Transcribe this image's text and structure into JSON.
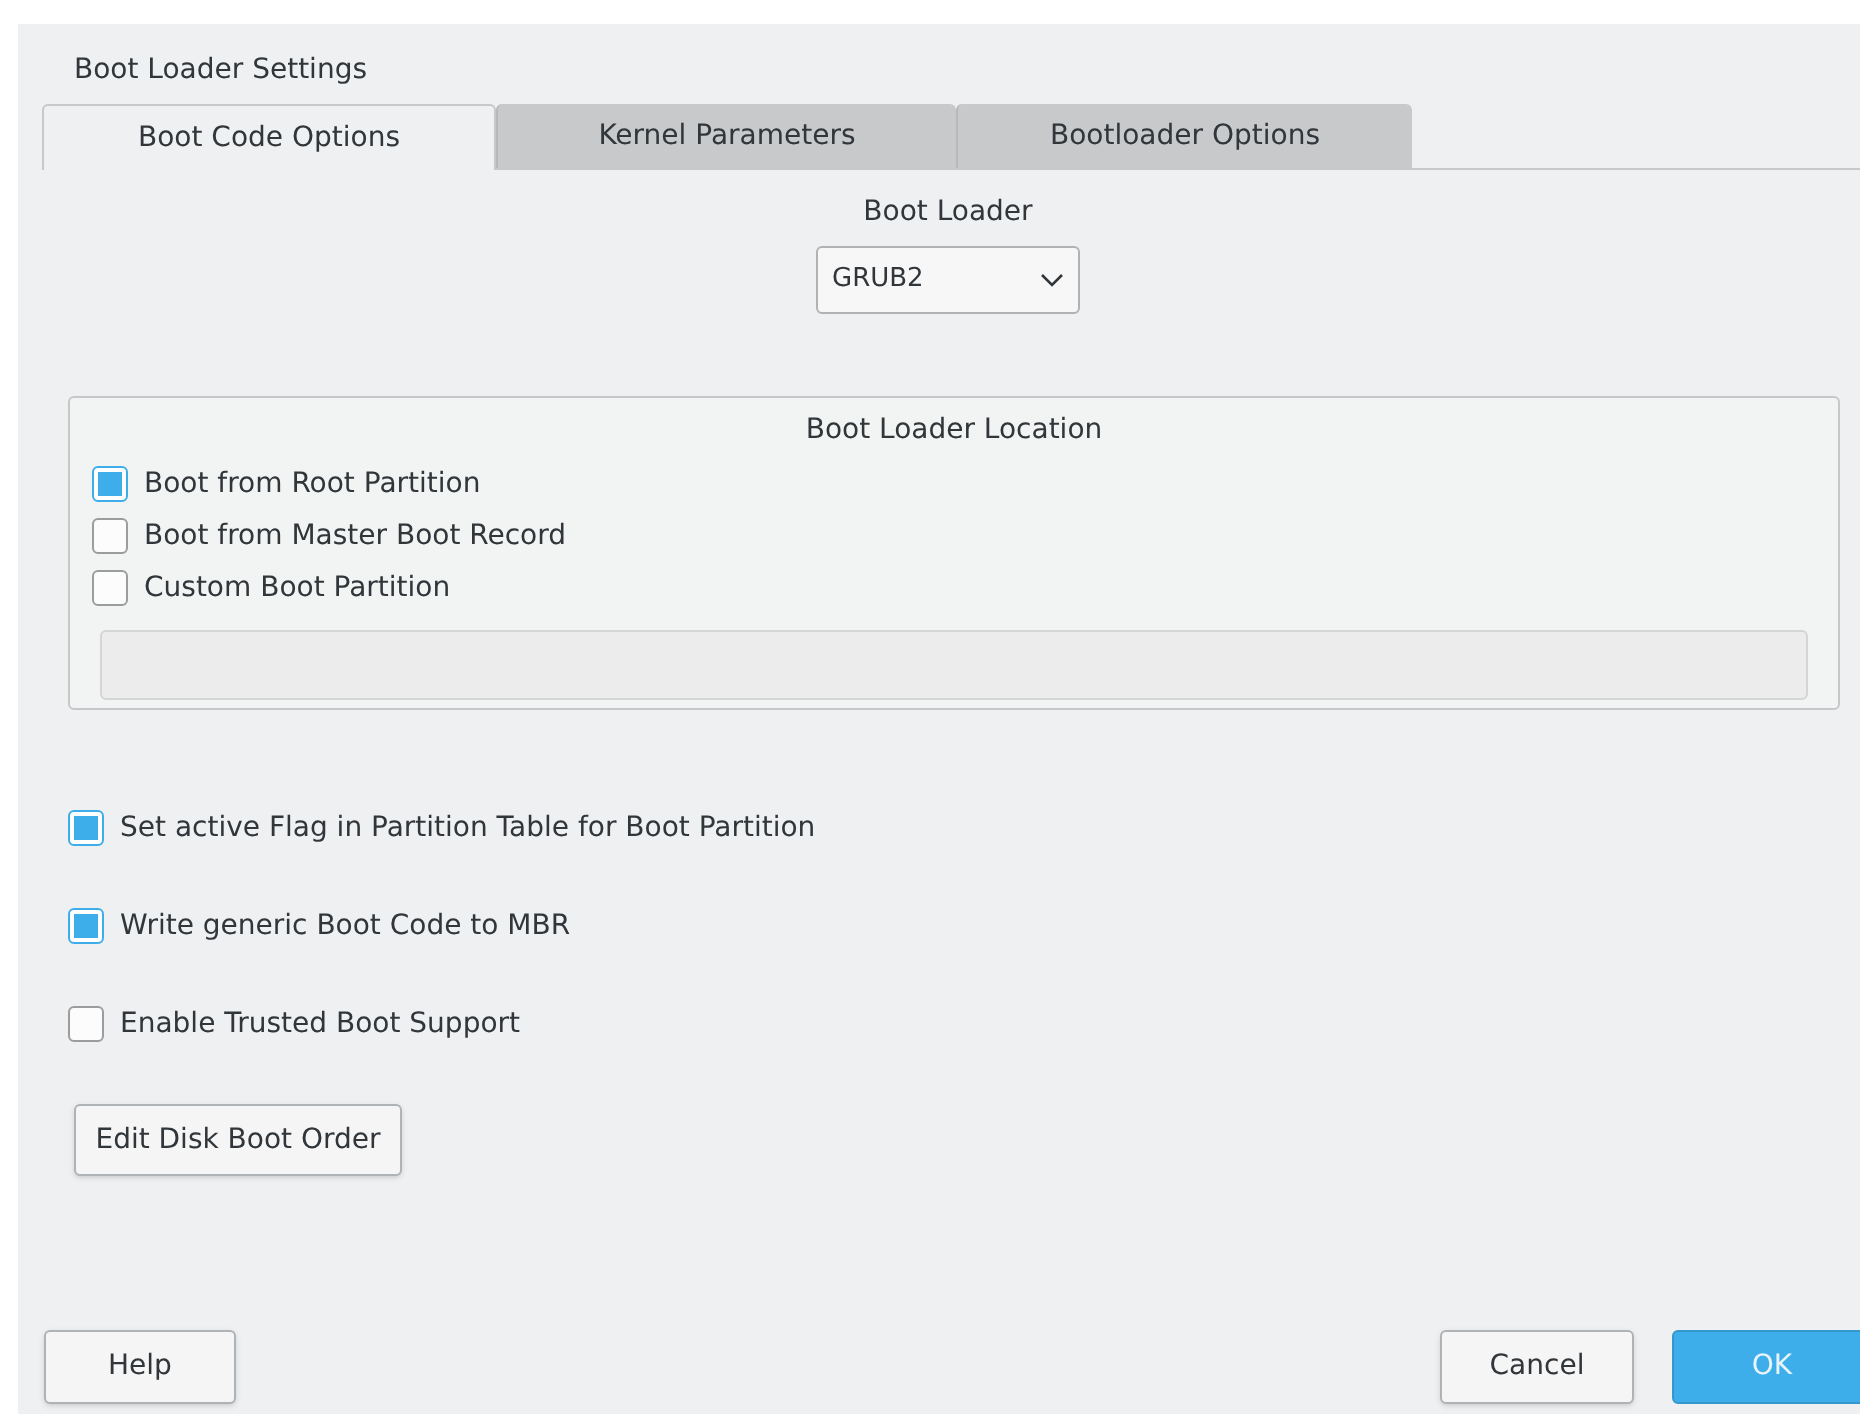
{
  "window": {
    "title": "Boot Loader Settings"
  },
  "tabs": [
    {
      "label": "Boot Code Options",
      "selected": true
    },
    {
      "label": "Kernel Parameters",
      "selected": false
    },
    {
      "label": "Bootloader Options",
      "selected": false
    }
  ],
  "boot_loader": {
    "label": "Boot Loader",
    "value": "GRUB2"
  },
  "location": {
    "title": "Boot Loader Location",
    "options": [
      {
        "label": "Boot from Root Partition",
        "checked": true
      },
      {
        "label": "Boot from Master Boot Record",
        "checked": false
      },
      {
        "label": "Custom Boot Partition",
        "checked": false
      }
    ],
    "custom_field": {
      "disabled": true
    }
  },
  "options": [
    {
      "label": "Set active Flag in Partition Table for Boot Partition",
      "checked": true
    },
    {
      "label": "Write generic Boot Code to MBR",
      "checked": true
    },
    {
      "label": "Enable Trusted Boot Support",
      "checked": false
    }
  ],
  "edit_button": "Edit Disk Boot Order",
  "buttons": [
    {
      "label": "Help",
      "default": false
    },
    {
      "label": "Cancel",
      "default": false
    },
    {
      "label": "OK",
      "default": true
    }
  ]
}
